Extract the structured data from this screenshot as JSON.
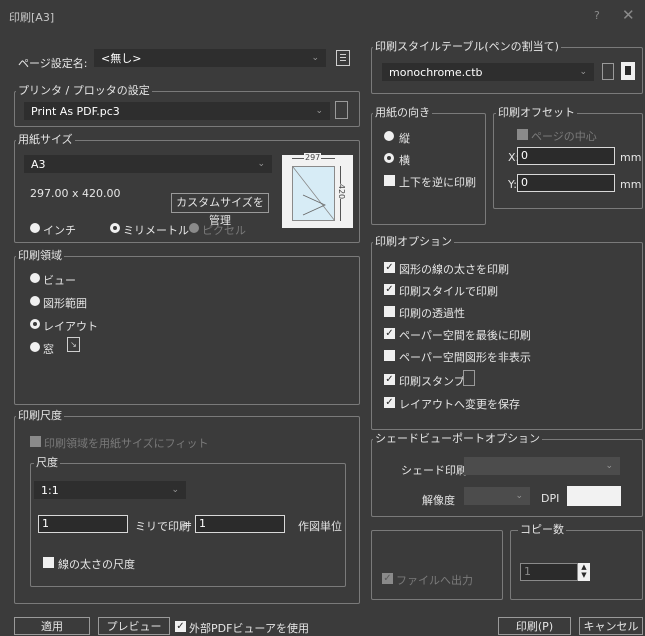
{
  "window": {
    "title": "印刷[A3]",
    "help": "?",
    "close": "✕"
  },
  "page_setup": {
    "label": "ページ設定名:",
    "value": "<無し>"
  },
  "printer": {
    "group": "プリンタ / プロッタの設定",
    "value": "Print As PDF.pc3"
  },
  "paper_size": {
    "group": "用紙サイズ",
    "value": "A3",
    "dims": "297.00 x 420.00",
    "custom_button": "カスタムサイズを管理",
    "preview_width": "297",
    "preview_height": "420",
    "units": [
      "インチ",
      "ミリメートル",
      "ピクセル"
    ]
  },
  "plot_style": {
    "group": "印刷スタイルテーブル(ペンの割当て)",
    "value": "monochrome.ctb"
  },
  "orientation": {
    "group": "用紙の向き",
    "portrait": "縦",
    "landscape": "横",
    "upside_down": "上下を逆に印刷"
  },
  "offset": {
    "group": "印刷オフセット",
    "center": "ページの中心",
    "x_label": "X:",
    "x_value": "0",
    "y_label": "Y:",
    "y_value": "0",
    "unit": "mm"
  },
  "plot_area": {
    "group": "印刷領域",
    "items": [
      "ビュー",
      "図形範囲",
      "レイアウト",
      "窓"
    ]
  },
  "plot_options": {
    "group": "印刷オプション",
    "items": [
      "図形の線の太さを印刷",
      "印刷スタイルで印刷",
      "印刷の透過性",
      "ペーパー空間を最後に印刷",
      "ペーパー空間図形を非表示",
      "印刷スタンプ",
      "レイアウトへ変更を保存"
    ]
  },
  "scale": {
    "group": "印刷尺度",
    "fit": "印刷領域を用紙サイズにフィット",
    "sub_group": "尺度",
    "value": "1:1",
    "mm_value": "1",
    "mm_label": "ミリで印刷",
    "equals": "=",
    "unit_value": "1",
    "unit_label": "作図単位",
    "lineweight": "線の太さの尺度"
  },
  "shade": {
    "group": "シェードビューポートオプション",
    "shade_label": "シェード印刷",
    "res_label": "解像度",
    "dpi_label": "DPI"
  },
  "copies": {
    "group": "コピー数",
    "value": "1"
  },
  "file": {
    "label": "ファイルへ出力"
  },
  "bottom": {
    "apply": "適用",
    "preview": "プレビュー",
    "external_pdf": "外部PDFビューアを使用",
    "print": "印刷(P)",
    "cancel": "キャンセル"
  }
}
